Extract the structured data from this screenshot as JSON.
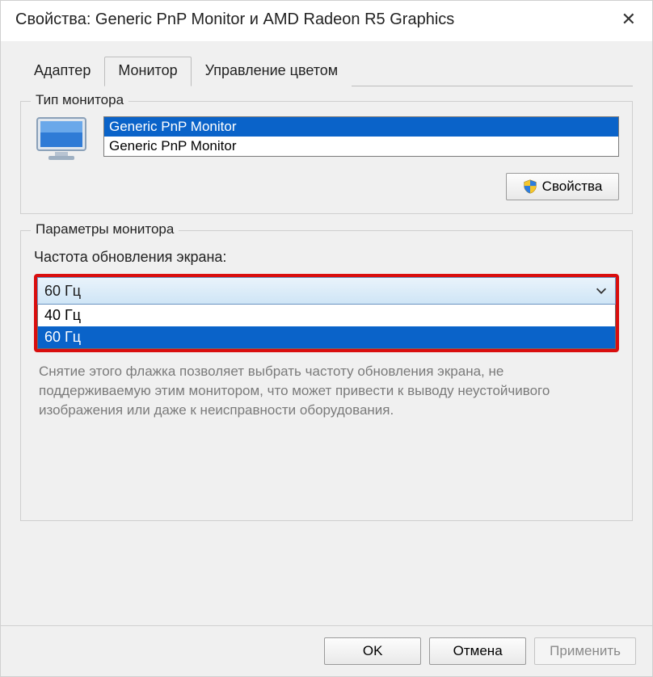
{
  "window": {
    "title": "Свойства: Generic PnP Monitor и AMD Radeon R5 Graphics"
  },
  "tabs": {
    "adapter": "Адаптер",
    "monitor": "Монитор",
    "color": "Управление цветом"
  },
  "monitor_type": {
    "group_title": "Тип монитора",
    "items": [
      "Generic PnP Monitor",
      "Generic PnP Monitor"
    ],
    "properties_button": "Свойства"
  },
  "monitor_params": {
    "group_title": "Параметры монитора",
    "refresh_label": "Частота обновления экрана:",
    "selected": "60 Гц",
    "options": [
      "40 Гц",
      "60 Гц"
    ],
    "help_text": "Снятие этого флажка позволяет выбрать частоту обновления экрана, не поддерживаемую этим монитором, что может привести к выводу неустойчивого изображения или даже к неисправности оборудования."
  },
  "footer": {
    "ok": "OK",
    "cancel": "Отмена",
    "apply": "Применить"
  }
}
